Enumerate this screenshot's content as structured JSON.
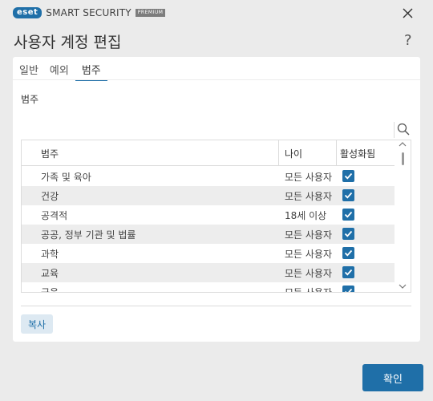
{
  "titlebar": {
    "brand": "eset",
    "product": "SMART SECURITY",
    "edition": "PREMIUM"
  },
  "header": {
    "title": "사용자 계정 편집",
    "help": "?"
  },
  "tabs": [
    {
      "label": "일반",
      "active": false
    },
    {
      "label": "예외",
      "active": false
    },
    {
      "label": "범주",
      "active": true
    }
  ],
  "section_label": "범주",
  "search": {
    "value": "",
    "placeholder": ""
  },
  "table": {
    "columns": [
      "범주",
      "나이",
      "활성화됨"
    ],
    "rows": [
      {
        "category": "가족 및 육아",
        "age": "모든 사용자",
        "enabled": true
      },
      {
        "category": "건강",
        "age": "모든 사용자",
        "enabled": true
      },
      {
        "category": "공격적",
        "age": "18세 이상",
        "enabled": true
      },
      {
        "category": "공공, 정부 기관 및 법률",
        "age": "모든 사용자",
        "enabled": true
      },
      {
        "category": "과학",
        "age": "모든 사용자",
        "enabled": true
      },
      {
        "category": "교육",
        "age": "모든 사용자",
        "enabled": true
      },
      {
        "category": "금융",
        "age": "모든 사용자",
        "enabled": true
      }
    ]
  },
  "buttons": {
    "copy": "복사",
    "ok": "확인"
  },
  "colors": {
    "accent": "#1f6fa8",
    "background": "#ebebeb",
    "panel": "#ffffff",
    "row_alt": "#ededed"
  },
  "icons": {
    "close": "close-icon",
    "search": "search-icon",
    "check": "check-icon",
    "scroll_up": "chevron-up-icon",
    "scroll_down": "chevron-down-icon"
  }
}
